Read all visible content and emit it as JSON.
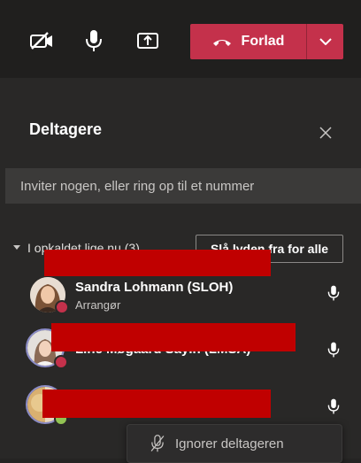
{
  "toolbar": {
    "camera_icon": "camera-off-icon",
    "mic_icon": "microphone-icon",
    "share_icon": "share-screen-icon",
    "leave_label": "Forlad",
    "leave_color": "#c4314b"
  },
  "panel": {
    "title": "Deltagere",
    "invite_placeholder": "Inviter nogen, eller ring op til et nummer",
    "section_label": "I opkaldet lige nu (3)",
    "mute_all_label": "Slå lyden fra for alle"
  },
  "participants": [
    {
      "name": "",
      "role": "",
      "status_color": "#c4314b"
    },
    {
      "name": "Sandra Lohmann (SLOH)",
      "role": "Arrangør",
      "status_color": "#c4314b"
    },
    {
      "name": "Line Møgaard Sayin (LMSA)",
      "role": "",
      "status_color": "#c4314b"
    },
    {
      "name": "",
      "role": "",
      "status_color": "#92c353"
    }
  ],
  "context_menu": {
    "ignore_label": "Ignorer deltageren"
  }
}
